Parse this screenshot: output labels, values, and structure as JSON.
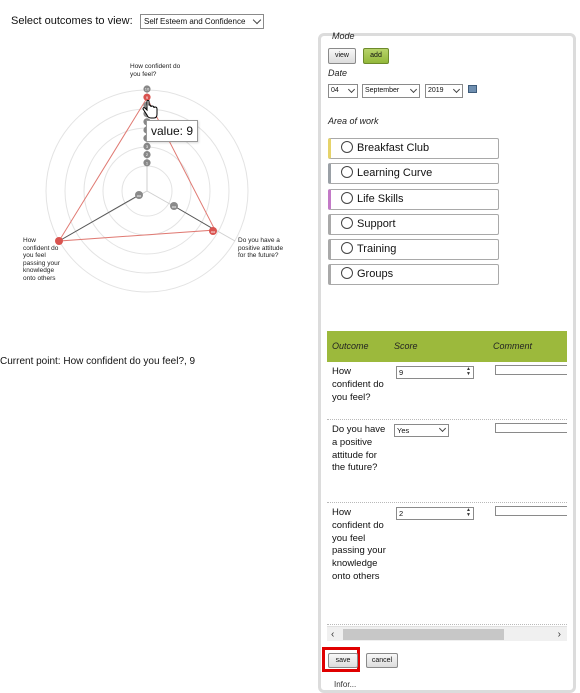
{
  "outcome_selector": {
    "label": "Select outcomes to view:",
    "selected": "Self Esteem and Confidence"
  },
  "radar": {
    "axes": [
      {
        "label": "How confident do you feel?",
        "value": 9
      },
      {
        "label": "Do you have a positive attitude for the future?",
        "value": 8
      },
      {
        "label": "How confident do you feel passing your knowledge onto others",
        "value": 10
      }
    ],
    "scale_max": 10,
    "tick_values": [
      "10",
      "9",
      "8",
      "7",
      "6",
      "5",
      "4",
      "3",
      "2",
      "1"
    ],
    "baseline_marks": [
      "oo",
      "oo",
      "oo"
    ],
    "tooltip": "value: 9",
    "colors": {
      "highlight": "#d9534f",
      "point": "#888888",
      "ring": "#dedede"
    }
  },
  "current_point": "Current point: How confident do you feel?, 9",
  "panel": {
    "mode_label": "Mode",
    "view_button": "view",
    "add_button": "add",
    "date_label": "Date",
    "date": {
      "day": "04",
      "month": "September",
      "year": "2019"
    },
    "area_label": "Area of work",
    "areas": [
      {
        "label": "Breakfast Club",
        "color": "#e6d36a"
      },
      {
        "label": "Learning Curve",
        "color": "#6fc36a"
      },
      {
        "label": "Life Skills",
        "color": "#9aa0a6"
      },
      {
        "label": "Support",
        "color": "#4aa35a"
      },
      {
        "label": "Training",
        "color": "#c37ac7"
      },
      {
        "label": "Groups",
        "color": "#e0a23d"
      }
    ]
  },
  "table": {
    "headers": [
      "Outcome",
      "Score",
      "Comment"
    ],
    "rows": [
      {
        "outcome": "How confident do you feel?",
        "score": "9",
        "type": "number"
      },
      {
        "outcome": "Do you have a positive attitude for the future?",
        "score": "Yes",
        "type": "select"
      },
      {
        "outcome": "How confident do you feel passing your knowledge onto others",
        "score": "2",
        "type": "number"
      }
    ]
  },
  "actions": {
    "save": "save",
    "cancel": "cancel",
    "footer_partial": "Infor..."
  }
}
